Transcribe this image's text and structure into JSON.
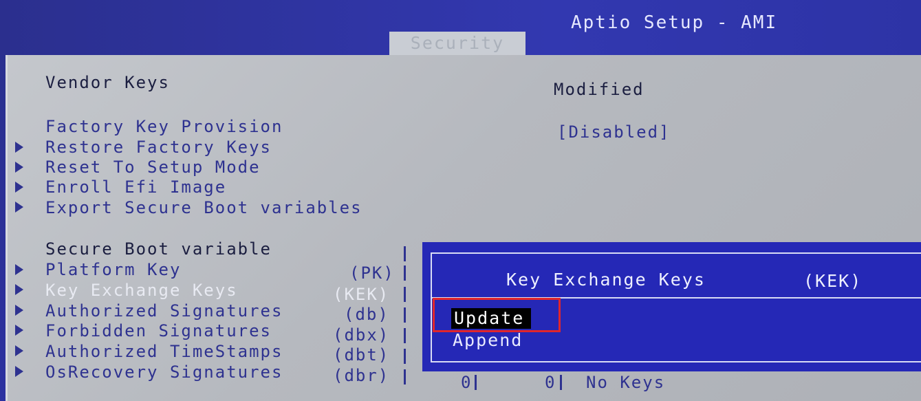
{
  "header": {
    "app_title": "Aptio Setup - AMI",
    "active_tab": "Security"
  },
  "panel": {
    "vendor_keys": {
      "label": "Vendor Keys",
      "value": "Modified"
    },
    "factory_key_provision": {
      "label": "Factory Key Provision",
      "value": "[Disabled]"
    },
    "submenus": [
      "Restore Factory Keys",
      "Reset To Setup Mode",
      "Enroll Efi Image",
      "Export Secure Boot variables"
    ],
    "variable_table": {
      "header": "Secure Boot variable",
      "rows": [
        {
          "name": "Platform Key",
          "abbr": "(PK)"
        },
        {
          "name": "Key Exchange Keys",
          "abbr": "(KEK)"
        },
        {
          "name": "Authorized Signatures",
          "abbr": "(db)"
        },
        {
          "name": "Forbidden  Signatures",
          "abbr": "(dbx)"
        },
        {
          "name": "Authorized TimeStamps",
          "abbr": "(dbt)"
        },
        {
          "name": "OsRecovery Signatures",
          "abbr": "(dbr)"
        }
      ],
      "last_row": {
        "size": "0",
        "count": "0",
        "status": "No Keys"
      }
    }
  },
  "popup": {
    "title": "Key Exchange Keys",
    "abbr": "(KEK)",
    "options": [
      "Update",
      "Append"
    ],
    "selected": "Update"
  }
}
